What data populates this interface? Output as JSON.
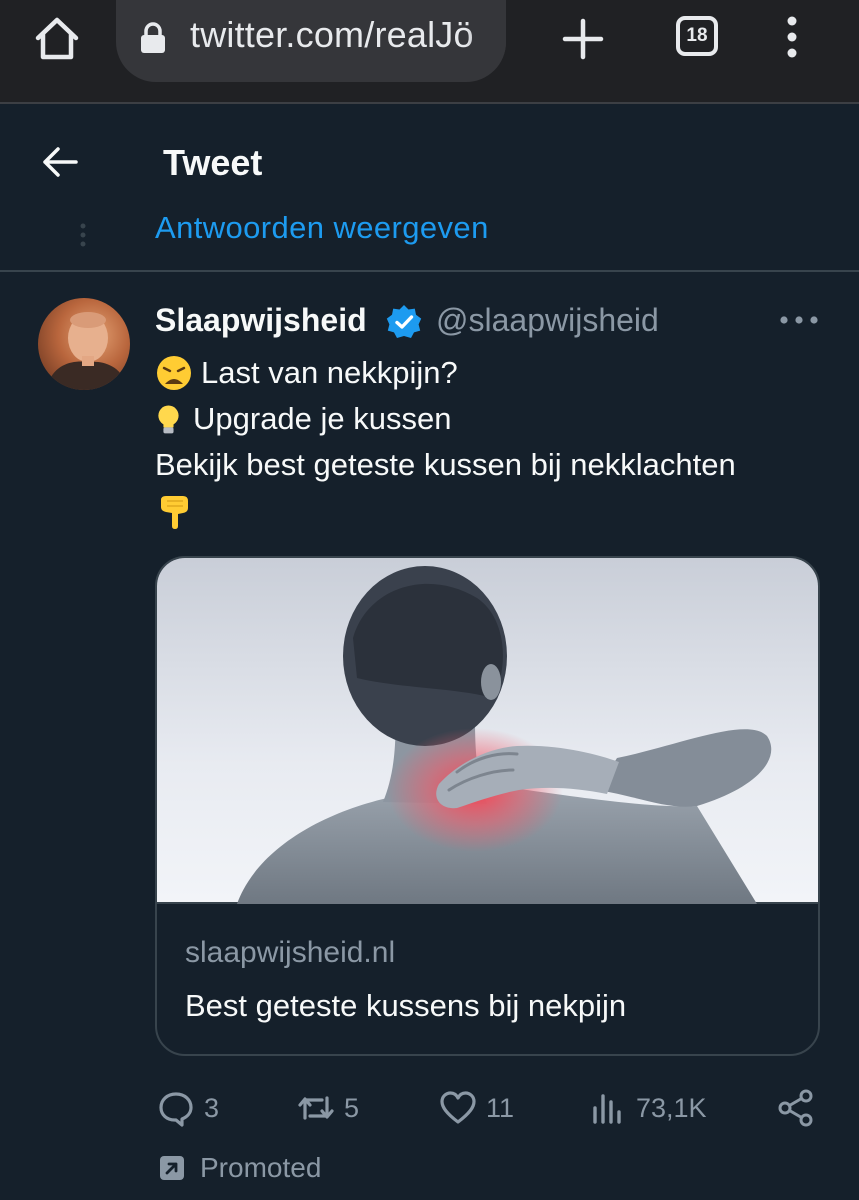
{
  "browser": {
    "url": "twitter.com/realJö",
    "tab_count": "18"
  },
  "header": {
    "title": "Tweet"
  },
  "thread": {
    "show_replies": "Antwoorden weergeven"
  },
  "tweet": {
    "author_name": "Slaapwijsheid",
    "author_handle": "@slaapwijsheid",
    "lines": [
      "Last van nekkpijn?",
      "Upgrade je kussen",
      "Bekijk best geteste kussen bij nekklachten"
    ],
    "emoji_names": [
      "weary-face-icon",
      "light-bulb-icon",
      "backhand-index-pointing-down-icon"
    ],
    "card": {
      "domain": "slaapwijsheid.nl",
      "title": "Best geteste kussens bij nekpijn"
    },
    "stats": {
      "replies": "3",
      "retweets": "5",
      "likes": "11",
      "views": "73,1K"
    },
    "promoted_label": "Promoted"
  },
  "colors": {
    "background": "#15202b",
    "accent": "#1d9bf0",
    "secondary_text": "#8b98a5",
    "border": "#38444d"
  }
}
